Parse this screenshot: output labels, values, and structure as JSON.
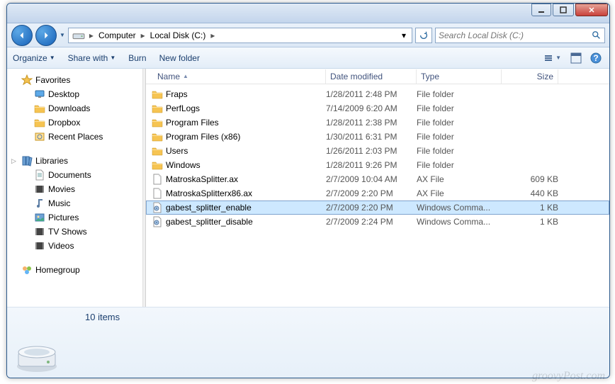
{
  "titlebar": {},
  "nav": {
    "address": [
      "Computer",
      "Local Disk (C:)"
    ],
    "search_placeholder": "Search Local Disk (C:)"
  },
  "toolbar": {
    "organize": "Organize",
    "share": "Share with",
    "burn": "Burn",
    "newfolder": "New folder"
  },
  "tree": {
    "favorites": {
      "label": "Favorites",
      "items": [
        "Desktop",
        "Downloads",
        "Dropbox",
        "Recent Places"
      ]
    },
    "libraries": {
      "label": "Libraries",
      "items": [
        "Documents",
        "Movies",
        "Music",
        "Pictures",
        "TV Shows",
        "Videos"
      ]
    },
    "homegroup": {
      "label": "Homegroup"
    }
  },
  "columns": {
    "name": "Name",
    "date": "Date modified",
    "type": "Type",
    "size": "Size"
  },
  "files": [
    {
      "icon": "folder",
      "name": "Fraps",
      "date": "1/28/2011 2:48 PM",
      "type": "File folder",
      "size": ""
    },
    {
      "icon": "folder",
      "name": "PerfLogs",
      "date": "7/14/2009 6:20 AM",
      "type": "File folder",
      "size": ""
    },
    {
      "icon": "folder",
      "name": "Program Files",
      "date": "1/28/2011 2:38 PM",
      "type": "File folder",
      "size": ""
    },
    {
      "icon": "folder",
      "name": "Program Files (x86)",
      "date": "1/30/2011 6:31 PM",
      "type": "File folder",
      "size": ""
    },
    {
      "icon": "folder",
      "name": "Users",
      "date": "1/26/2011 2:03 PM",
      "type": "File folder",
      "size": ""
    },
    {
      "icon": "folder",
      "name": "Windows",
      "date": "1/28/2011 9:26 PM",
      "type": "File folder",
      "size": ""
    },
    {
      "icon": "file",
      "name": "MatroskaSplitter.ax",
      "date": "2/7/2009 10:04 AM",
      "type": "AX File",
      "size": "609 KB"
    },
    {
      "icon": "file",
      "name": "MatroskaSplitterx86.ax",
      "date": "2/7/2009 2:20 PM",
      "type": "AX File",
      "size": "440 KB"
    },
    {
      "icon": "cmd",
      "name": "gabest_splitter_enable",
      "date": "2/7/2009 2:20 PM",
      "type": "Windows Comma...",
      "size": "1 KB",
      "selected": true
    },
    {
      "icon": "cmd",
      "name": "gabest_splitter_disable",
      "date": "2/7/2009 2:24 PM",
      "type": "Windows Comma...",
      "size": "1 KB"
    }
  ],
  "details": {
    "count": "10 items"
  },
  "watermark": "groovyPost.com"
}
